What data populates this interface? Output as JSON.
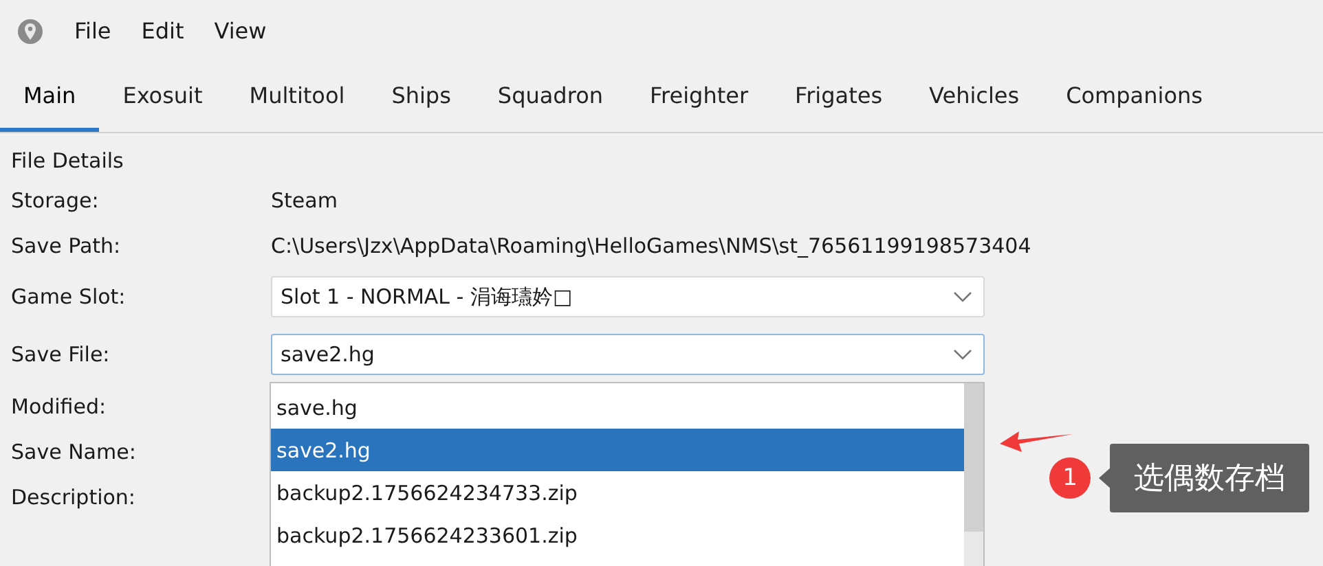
{
  "menu": [
    "File",
    "Edit",
    "View"
  ],
  "tabs": [
    {
      "label": "Main",
      "selected": true
    },
    {
      "label": "Exosuit",
      "selected": false
    },
    {
      "label": "Multitool",
      "selected": false
    },
    {
      "label": "Ships",
      "selected": false
    },
    {
      "label": "Squadron",
      "selected": false
    },
    {
      "label": "Freighter",
      "selected": false
    },
    {
      "label": "Frigates",
      "selected": false
    },
    {
      "label": "Vehicles",
      "selected": false
    },
    {
      "label": "Companions",
      "selected": false
    }
  ],
  "section_title": "File Details",
  "fields": [
    {
      "kind": "text",
      "label": "Storage:",
      "value": "Steam"
    },
    {
      "kind": "text",
      "label": "Save Path:",
      "value": "C:\\Users\\Jzx\\AppData\\Roaming\\HelloGames\\NMS\\st_76561199198573404"
    },
    {
      "kind": "combo",
      "label": "Game Slot:",
      "value": "Slot 1 - NORMAL - 涓诲瓙妗□",
      "focused": false
    },
    {
      "kind": "combo",
      "label": "Save File:",
      "value": "save2.hg",
      "focused": true
    },
    {
      "kind": "text",
      "label": "Modified:"
    },
    {
      "kind": "text",
      "label": "Save Name:"
    },
    {
      "kind": "text",
      "label": "Description:"
    }
  ],
  "dropdown": [
    {
      "label": "save.hg",
      "selected": false
    },
    {
      "label": "save2.hg",
      "selected": true
    },
    {
      "label": "backup2.1756624234733.zip",
      "selected": false
    },
    {
      "label": "backup2.1756624233601.zip",
      "selected": false
    }
  ],
  "annotation": {
    "number": "1",
    "text": "选偶数存档"
  }
}
